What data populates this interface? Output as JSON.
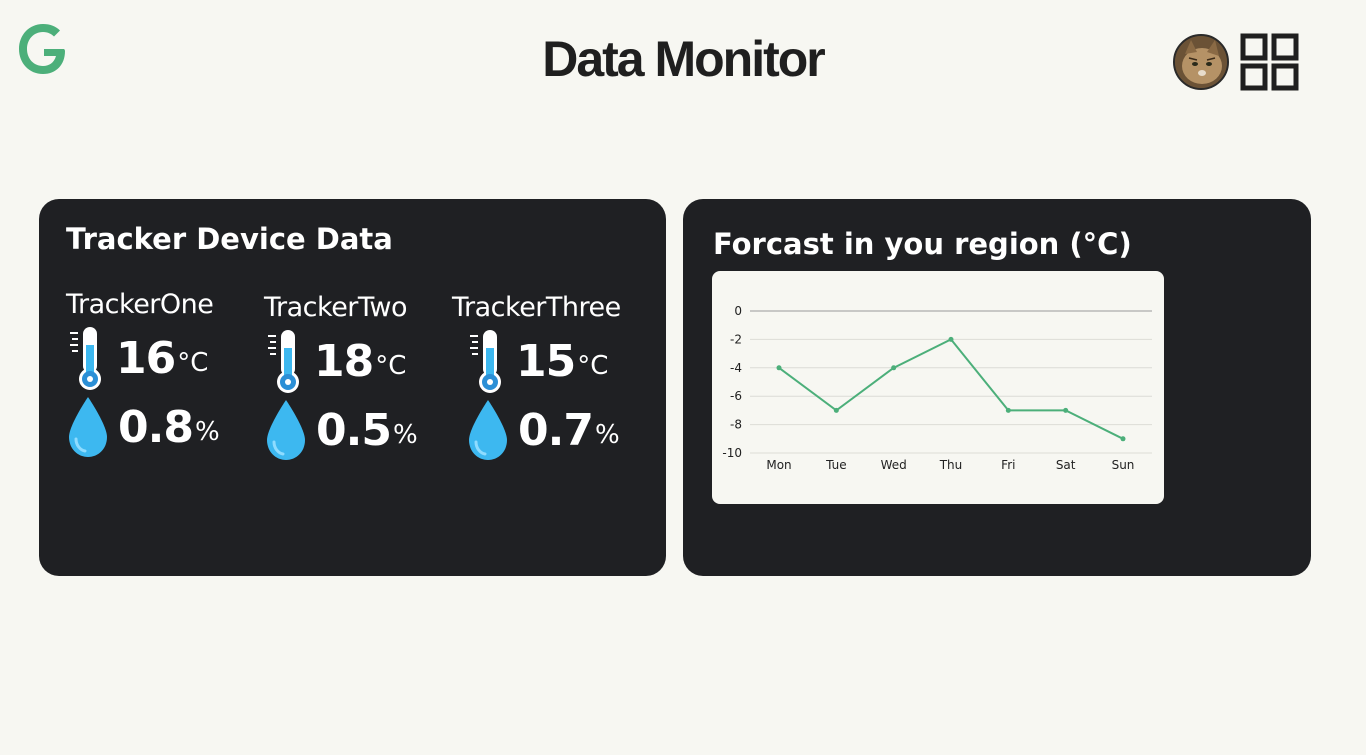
{
  "header": {
    "title": "Data Monitor",
    "logo_icon": "g-logo-icon",
    "avatar_icon": "cat-avatar",
    "menu_icon": "grid-menu-icon"
  },
  "colors": {
    "background": "#f7f7f2",
    "card": "#1f2023",
    "accent_green": "#4caf7a",
    "water_blue": "#3db8f0"
  },
  "trackers_panel": {
    "title": "Tracker Device Data",
    "trackers": [
      {
        "name": "TrackerOne",
        "temperature": "16",
        "temperature_unit": "°C",
        "humidity": "0.8",
        "humidity_unit": "%"
      },
      {
        "name": "TrackerTwo",
        "temperature": "18",
        "temperature_unit": "°C",
        "humidity": "0.5",
        "humidity_unit": "%"
      },
      {
        "name": "TrackerThree",
        "temperature": "15",
        "temperature_unit": "°C",
        "humidity": "0.7",
        "humidity_unit": "%"
      }
    ]
  },
  "forecast_panel": {
    "title": "Forcast in you region (°C)"
  },
  "chart_data": {
    "type": "line",
    "title": "",
    "xlabel": "",
    "ylabel": "",
    "categories": [
      "Mon",
      "Tue",
      "Wed",
      "Thu",
      "Fri",
      "Sat",
      "Sun"
    ],
    "values": [
      -4,
      -7,
      -4,
      -2,
      -7,
      -7,
      -9
    ],
    "ylim": [
      -10,
      0
    ],
    "yticks": [
      "0",
      "-2",
      "-4",
      "-6",
      "-8",
      "-10"
    ],
    "grid": true,
    "line_color": "#4caf7a"
  }
}
